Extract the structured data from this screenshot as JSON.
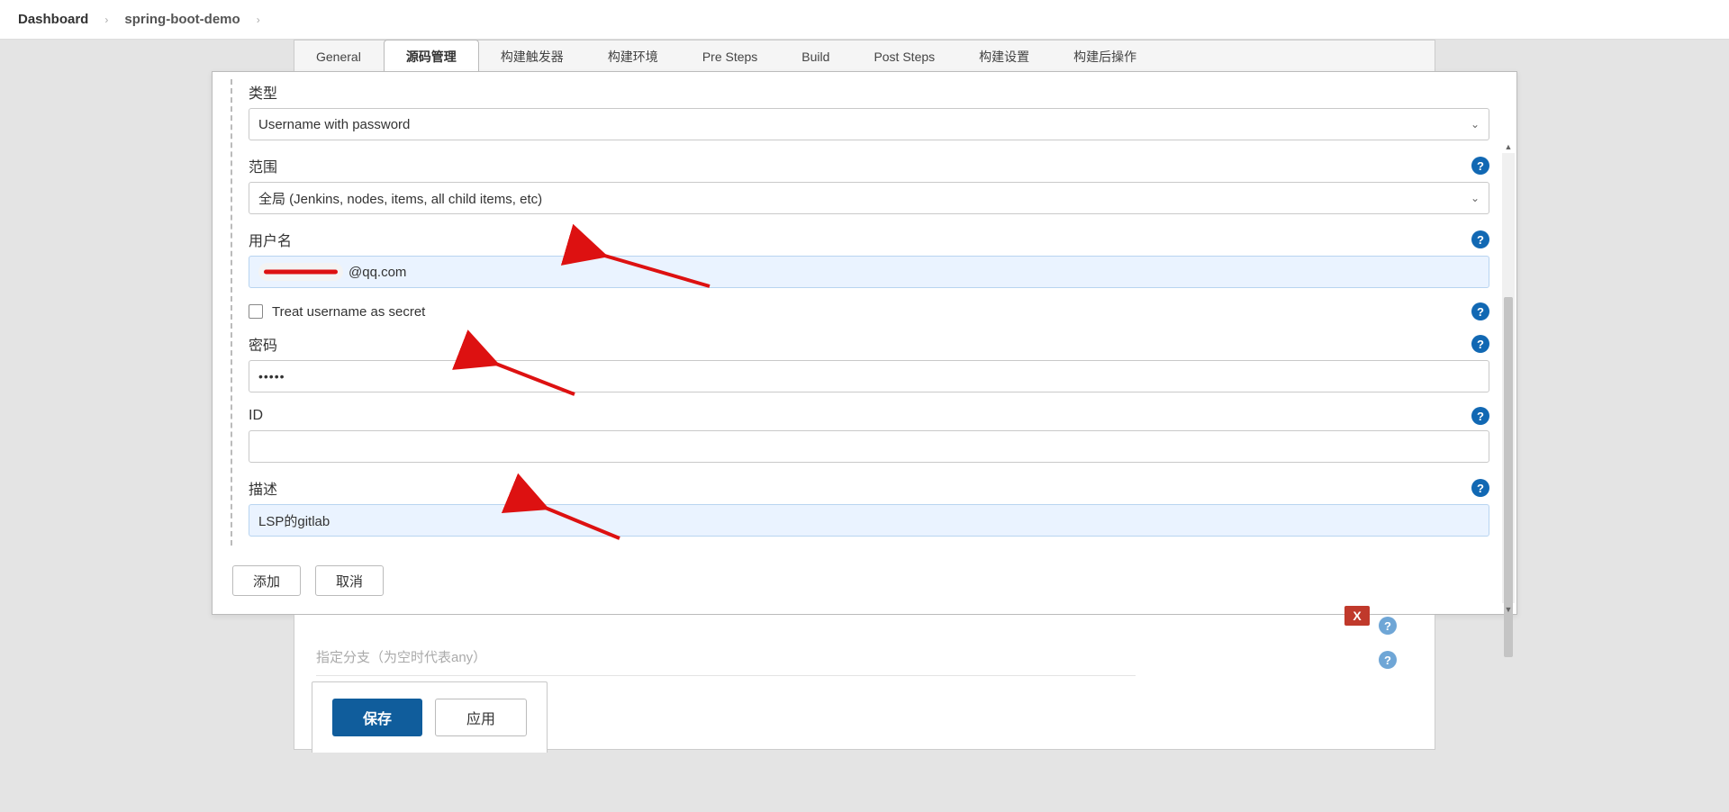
{
  "breadcrumb": {
    "dashboard": "Dashboard",
    "project": "spring-boot-demo"
  },
  "tabs": {
    "general": "General",
    "scm": "源码管理",
    "triggers": "构建触发器",
    "env": "构建环境",
    "presteps": "Pre Steps",
    "build": "Build",
    "poststeps": "Post Steps",
    "settings": "构建设置",
    "postactions": "构建后操作"
  },
  "form": {
    "type_label": "类型",
    "type_value": "Username with password",
    "scope_label": "范围",
    "scope_value": "全局 (Jenkins, nodes, items, all child items, etc)",
    "username_label": "用户名",
    "username_suffix": "@qq.com",
    "treat_secret_label": "Treat username as secret",
    "password_label": "密码",
    "password_value": "•••••",
    "id_label": "ID",
    "id_value": "",
    "desc_label": "描述",
    "desc_value": "LSP的gitlab"
  },
  "modal_buttons": {
    "add": "添加",
    "cancel": "取消"
  },
  "behind": {
    "branch_label": "指定分支（为空时代表any）",
    "close_x": "X"
  },
  "footer_buttons": {
    "save": "保存",
    "apply": "应用"
  },
  "icons": {
    "help": "?",
    "caret": "⌄",
    "up": "▲",
    "down": "▼"
  }
}
